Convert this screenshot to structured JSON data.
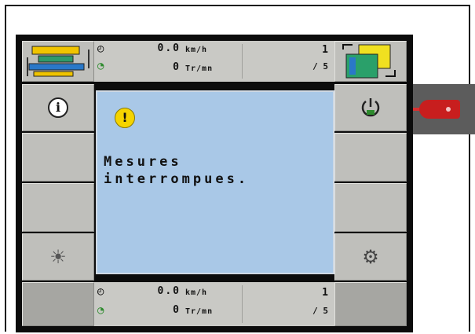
{
  "status_top": {
    "speed": "0.0",
    "speed_unit": "km/h",
    "rpm": "0",
    "rpm_unit": "Tr/mn",
    "page": "1",
    "page_total": "/ 5"
  },
  "status_bottom": {
    "speed": "0.0",
    "speed_unit": "km/h",
    "rpm": "0",
    "rpm_unit": "Tr/mn",
    "page": "1",
    "page_total": "/ 5"
  },
  "dialog": {
    "icon": "warning-icon",
    "message": "Mesures\ninterrompues."
  },
  "left_softkeys": [
    "info-icon",
    "",
    "",
    "brightness-icon",
    ""
  ],
  "right_softkeys": [
    "power-icon",
    "",
    "",
    "settings-icon",
    ""
  ],
  "colors": {
    "dialog_bg": "#a9c8e7",
    "softkey_bg": "#bfbfbb",
    "warning": "#f5d400",
    "plug": "#c81e1e"
  }
}
